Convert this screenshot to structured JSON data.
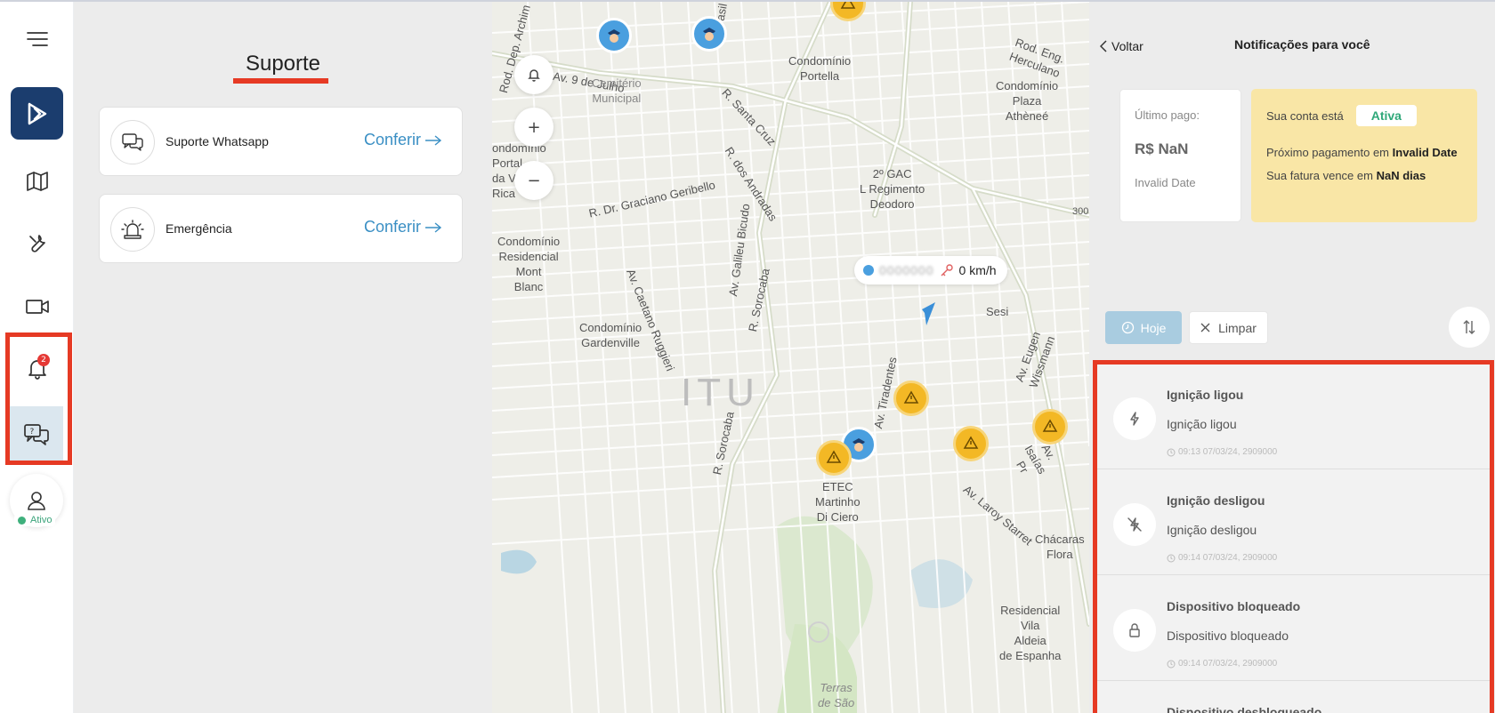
{
  "sidebar": {
    "notification_badge": "2",
    "profile_status": "Ativo",
    "icons": [
      "menu-icon",
      "logo-icon",
      "map-icon",
      "wrench-icon",
      "video-icon",
      "bell-icon",
      "support-chat-icon",
      "user-icon"
    ]
  },
  "support": {
    "title": "Suporte",
    "items": [
      {
        "label": "Suporte Whatsapp",
        "link": "Conferir",
        "icon": "chat-bubbles-icon"
      },
      {
        "label": "Emergência",
        "link": "Conferir",
        "icon": "siren-icon"
      }
    ]
  },
  "map": {
    "city": "ITU",
    "speed": "0 km/h",
    "plate_masked": "0000000",
    "labels": {
      "av_9_julho": "Av. 9 de Julho",
      "cemiterio": "Cemitério\nMunicipal",
      "portella": "Condomínio\nPortella",
      "plaza": "Condomínio\nPlaza\nAthèneé",
      "gac": "2º GAC\nL Regimento\nDeodoro",
      "graciano": "R. Dr. Graciano Geribello",
      "santa_cruz": "R. Santa Cruz",
      "andradas": "R. dos Andradas",
      "mont_blanc": "Condomínio\nResidencial\nMont\nBlanc",
      "gardenville": "Condomínio\nGardenville",
      "sesi": "Sesi",
      "etec": "ETEC\nMartinho\nDi Ciero",
      "chacaras": "Chácaras\nFlora",
      "vila_aldeia": "Residencial\nVila\nAldeia\nde Espanha",
      "tiradentes": "Av. Tiradentes",
      "laroy": "Av. Laroy Starret",
      "sorocaba": "R. Sorocaba",
      "ruggieri": "Av. Caetano Ruggieri",
      "galileu": "Av. Galileu Bicudo",
      "wissmann": "Av. Eugen Wissmann",
      "eng_herculano": "Rod. Eng. Herculano",
      "terras": "Terras\nde São",
      "portal": "ondomínio\nPortal\nda Vi\nRica",
      "rod_archim": "Rod. Dep. Archim",
      "rasil": "rasil",
      "route_300": "300",
      "isaias": "Av. Isaías Pr"
    },
    "controls": [
      "bell-icon",
      "+",
      "−"
    ]
  },
  "right_panel": {
    "back": "Voltar",
    "title": "Notificações para você",
    "payment": {
      "label": "Último pago:",
      "value": "R$ NaN",
      "date": "Invalid Date"
    },
    "account": {
      "status_prefix": "Sua conta está",
      "status": "Ativa",
      "next_payment_prefix": "Próximo pagamento em",
      "next_payment_value": "Invalid Date",
      "due_prefix": "Sua fatura vence em",
      "due_value": "NaN dias"
    },
    "filters": {
      "today": "Hoje",
      "clear": "Limpar"
    },
    "notifications": [
      {
        "title": "Ignição ligou",
        "body": "Ignição ligou",
        "time": "09:13 07/03/24, 2909000",
        "icon": "lightning-icon"
      },
      {
        "title": "Ignição desligou",
        "body": "Ignição desligou",
        "time": "09:14 07/03/24, 2909000",
        "icon": "lightning-off-icon"
      },
      {
        "title": "Dispositivo bloqueado",
        "body": "Dispositivo bloqueado",
        "time": "09:14 07/03/24, 2909000",
        "icon": "lock-icon"
      }
    ],
    "partial_next_title": "Dispositivo desbloqueado"
  },
  "colors": {
    "accent_red": "#e63a24",
    "brand_navy": "#1b3d6e",
    "link_blue": "#3a8fc4",
    "active_green": "#2fa879",
    "account_yellow": "#f9e6a6"
  }
}
